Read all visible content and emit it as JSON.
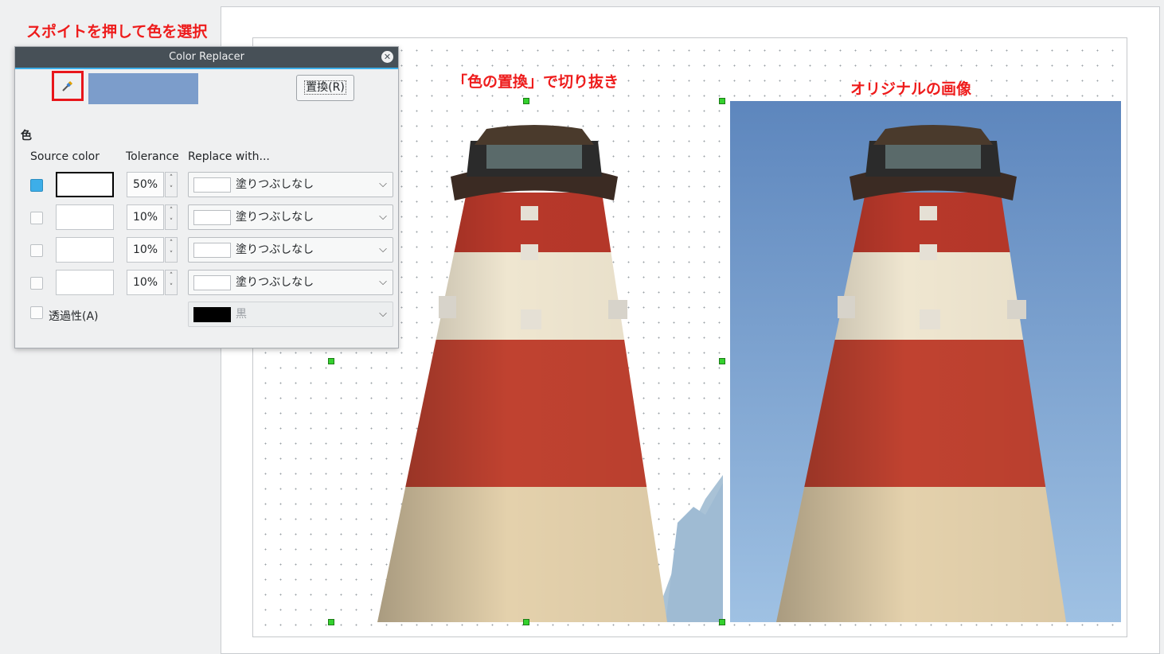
{
  "annotations": {
    "pipette_hint": "スポイトを押して色を選択",
    "cut_label": "「色の置換」で切り抜き",
    "original_label": "オリジナルの画像"
  },
  "dialog": {
    "title": "Color Replacer",
    "replace_button": "置換(R)",
    "pipette_color": "#7c9dcb",
    "section_label": "色",
    "columns": {
      "source": "Source color",
      "tolerance": "Tolerance",
      "replace": "Replace with..."
    },
    "rows": [
      {
        "checked": true,
        "tolerance": "50%",
        "replace": "塗りつぶしなし"
      },
      {
        "checked": false,
        "tolerance": "10%",
        "replace": "塗りつぶしなし"
      },
      {
        "checked": false,
        "tolerance": "10%",
        "replace": "塗りつぶしなし"
      },
      {
        "checked": false,
        "tolerance": "10%",
        "replace": "塗りつぶしなし"
      }
    ],
    "transparency_label": "透過性(A)",
    "transparency_color": "黒"
  },
  "colors": {
    "accent": "#3daee9",
    "title_bar": "#475057",
    "annotation_red": "#ee1c1c",
    "sky_blue": "#6f95c7",
    "handle_green": "#34d12e"
  },
  "icons": [
    "pipette-icon",
    "close-icon",
    "chevron-down-icon",
    "spin-up-icon",
    "spin-down-icon"
  ]
}
